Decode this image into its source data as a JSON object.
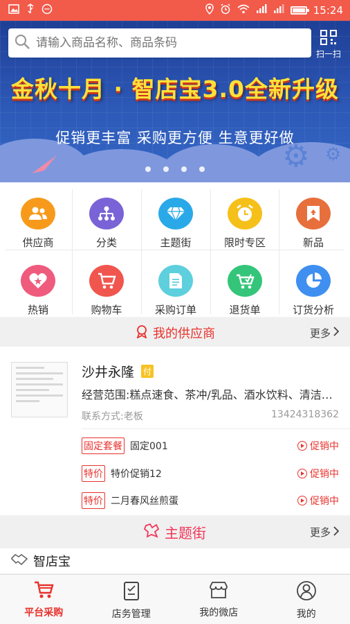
{
  "status_bar": {
    "time": "15:24"
  },
  "search": {
    "placeholder": "请输入商品名称、商品条码",
    "scan_label": "扫一扫"
  },
  "banner": {
    "title": "金秋十月 · 智店宝3.0全新升级",
    "subtitle": "促销更丰富  采购更方便  生意更好做",
    "page_count": 4
  },
  "categories": [
    {
      "label": "供应商",
      "icon": "suppliers-icon",
      "color": "#f79a1b"
    },
    {
      "label": "分类",
      "icon": "category-tree-icon",
      "color": "#7a63d6"
    },
    {
      "label": "主题街",
      "icon": "diamond-icon",
      "color": "#2aa9e8"
    },
    {
      "label": "限时专区",
      "icon": "alarm-clock-icon",
      "color": "#f5c019"
    },
    {
      "label": "新品",
      "icon": "new-bookmark-icon",
      "color": "#e76f3c"
    },
    {
      "label": "热销",
      "icon": "hot-heart-icon",
      "color": "#ef5b7d"
    },
    {
      "label": "购物车",
      "icon": "cart-icon",
      "color": "#f0564e"
    },
    {
      "label": "采购订单",
      "icon": "order-document-icon",
      "color": "#5ecfdc"
    },
    {
      "label": "退货单",
      "icon": "return-cart-icon",
      "color": "#35c57a"
    },
    {
      "label": "订货分析",
      "icon": "pie-chart-icon",
      "color": "#3e8ff0"
    }
  ],
  "supplier_section": {
    "title": "我的供应商",
    "more": "更多"
  },
  "supplier": {
    "name": "沙井永隆",
    "badge": "付",
    "scope": "经营范围:糕点速食、茶冲/乳品、酒水饮料、清洁用品",
    "contact": "联系方式:老板",
    "phone": "13424318362",
    "promotions": [
      {
        "tag": "固定套餐",
        "name": "固定001",
        "status": "促销中"
      },
      {
        "tag": "特价",
        "name": "特价促销12",
        "status": "促销中"
      },
      {
        "tag": "特价",
        "name": "二月春风丝煎蛋",
        "status": "促销中"
      }
    ]
  },
  "theme_section": {
    "title": "主题街",
    "more": "更多"
  },
  "brand": {
    "name": "智店宝"
  },
  "tabs": [
    {
      "label": "平台采购",
      "icon": "cart-icon",
      "active": true
    },
    {
      "label": "店务管理",
      "icon": "clipboard-icon",
      "active": false
    },
    {
      "label": "我的微店",
      "icon": "shop-icon",
      "active": false
    },
    {
      "label": "我的",
      "icon": "user-icon",
      "active": false
    }
  ],
  "colors": {
    "accent": "#e8312c",
    "status_bar": "#f25a4a",
    "theme": "#f2375a"
  }
}
